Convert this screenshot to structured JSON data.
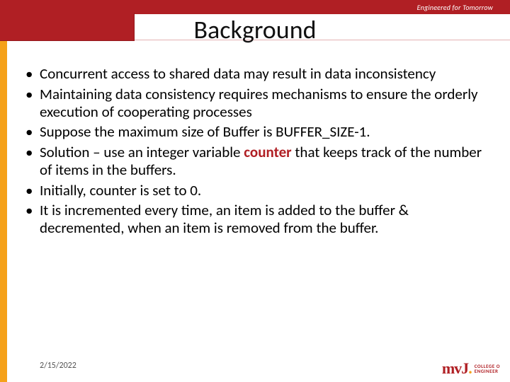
{
  "header": {
    "tagline": "Engineered for Tomorrow",
    "title": "Background"
  },
  "bullets": [
    {
      "pre": "Concurrent access to shared data may result in data inconsistency",
      "mid": "",
      "post": ""
    },
    {
      "pre": "Maintaining data consistency requires mechanisms to ensure the orderly execution of cooperating processes",
      "mid": "",
      "post": ""
    },
    {
      "pre": "Suppose the maximum size of Buffer is BUFFER_SIZE-1.",
      "mid": "",
      "post": ""
    },
    {
      "pre": "Solution – use an integer variable ",
      "mid": "counter",
      "post": " that keeps track of the number of  items in the buffers."
    },
    {
      "pre": " Initially, counter  is set to 0.",
      "mid": "",
      "post": ""
    },
    {
      "pre": "It is incremented every time, an item is added to the buffer & decremented, when an item is removed from the buffer.",
      "mid": "",
      "post": ""
    }
  ],
  "footer": {
    "date": "2/15/2022",
    "logo_mark": "mvJ",
    "logo_line1": "COLLEGE O",
    "logo_line2": "ENGINEER"
  }
}
